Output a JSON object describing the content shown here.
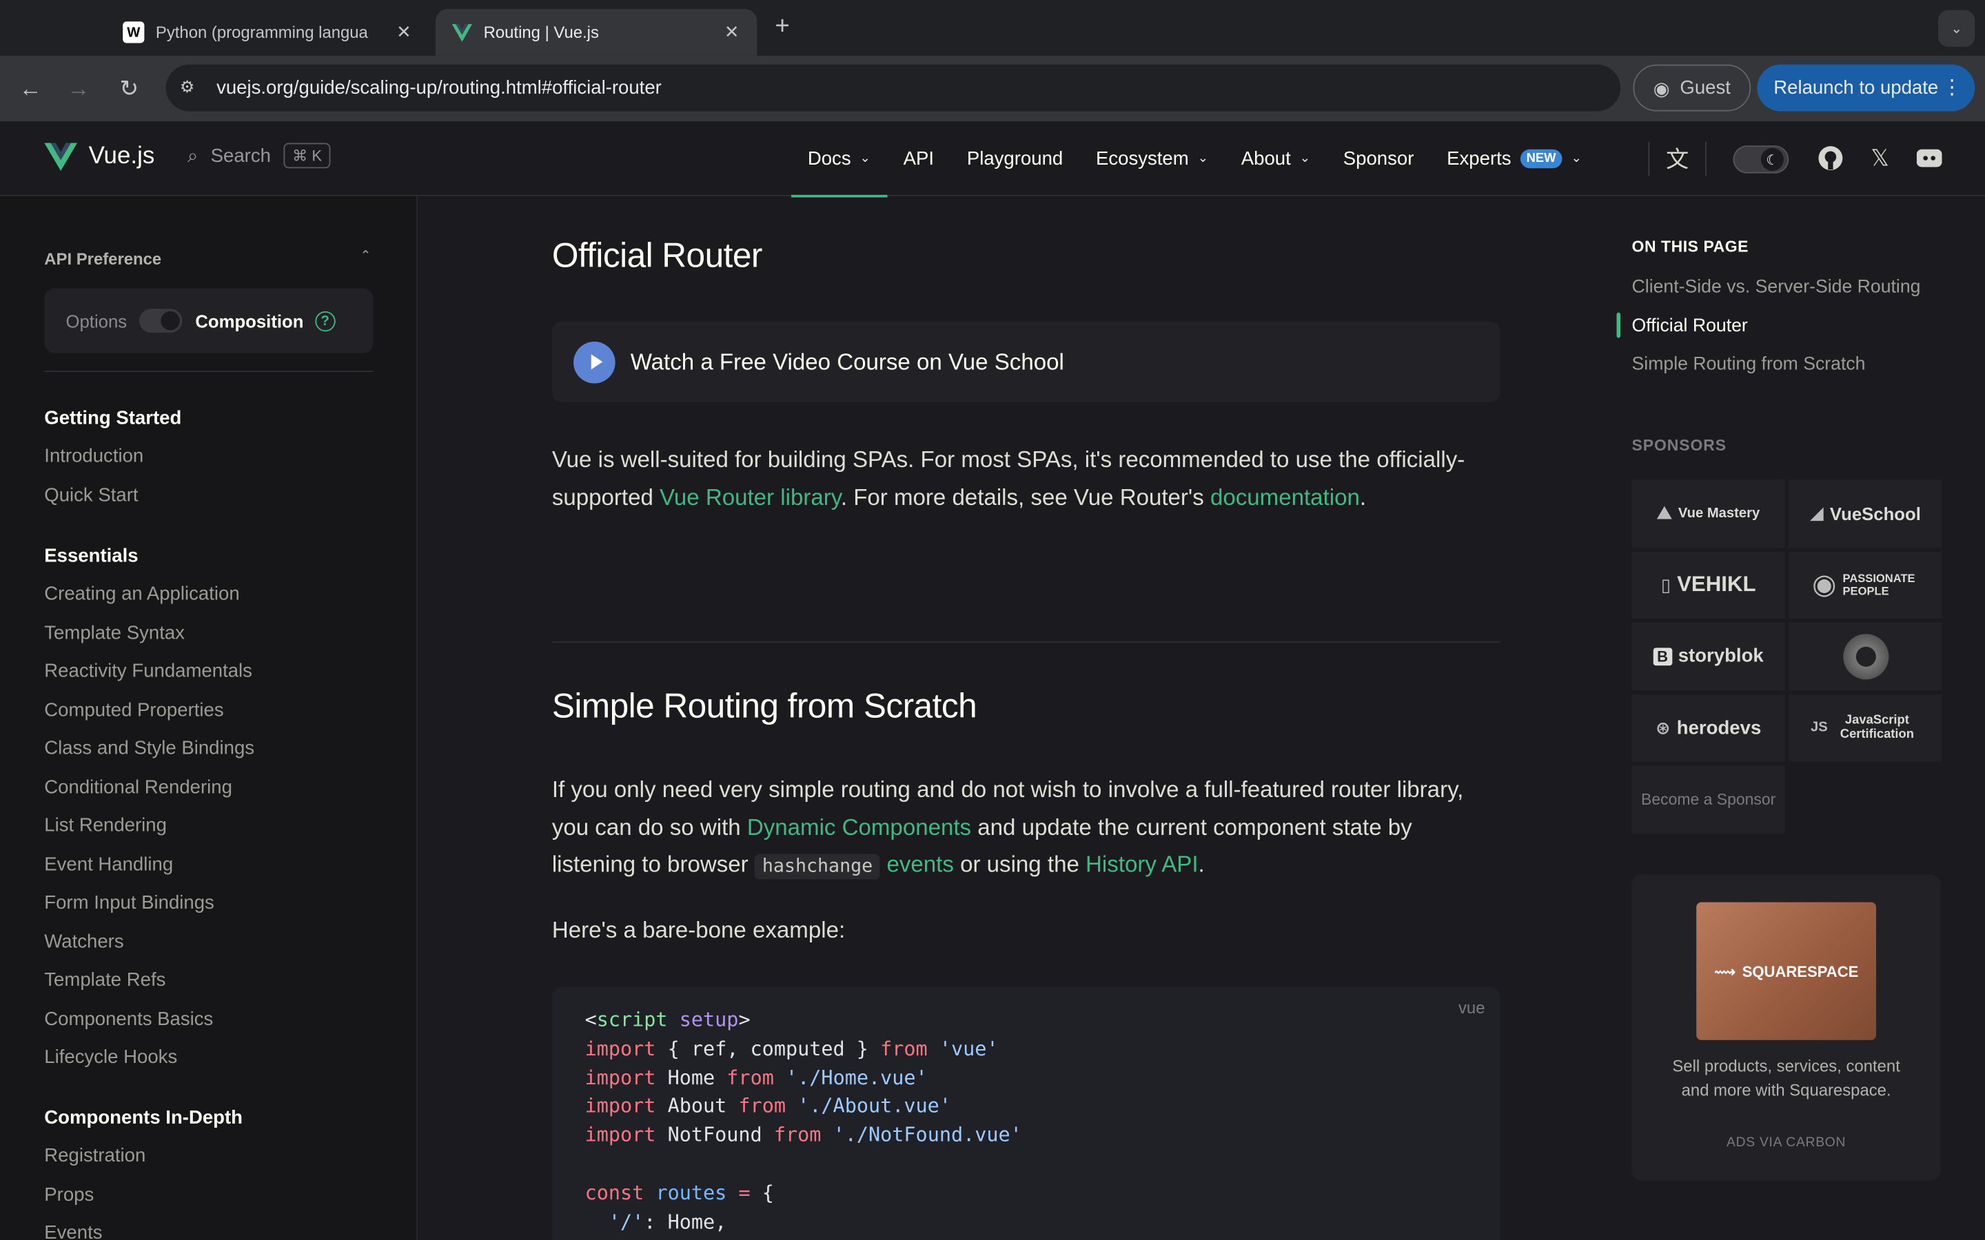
{
  "browser": {
    "tabs": [
      {
        "title": "Python (programming langua",
        "favicon": "W"
      },
      {
        "title": "Routing | Vue.js",
        "favicon": "V"
      }
    ],
    "url": "vuejs.org/guide/scaling-up/routing.html#official-router",
    "guest_label": "Guest",
    "relaunch_label": "Relaunch to update"
  },
  "nav": {
    "brand": "Vue.js",
    "search_label": "Search",
    "search_kbd": "⌘ K",
    "items": [
      {
        "label": "Docs",
        "dropdown": true
      },
      {
        "label": "API"
      },
      {
        "label": "Playground"
      },
      {
        "label": "Ecosystem",
        "dropdown": true
      },
      {
        "label": "About",
        "dropdown": true
      },
      {
        "label": "Sponsor"
      },
      {
        "label": "Experts",
        "badge": "NEW",
        "dropdown": true
      }
    ]
  },
  "sidebar": {
    "api_preference": {
      "title": "API Preference",
      "options_label": "Options",
      "composition_label": "Composition"
    },
    "groups": [
      {
        "title": "Getting Started",
        "items": [
          "Introduction",
          "Quick Start"
        ]
      },
      {
        "title": "Essentials",
        "items": [
          "Creating an Application",
          "Template Syntax",
          "Reactivity Fundamentals",
          "Computed Properties",
          "Class and Style Bindings",
          "Conditional Rendering",
          "List Rendering",
          "Event Handling",
          "Form Input Bindings",
          "Watchers",
          "Template Refs",
          "Components Basics",
          "Lifecycle Hooks"
        ]
      },
      {
        "title": "Components In-Depth",
        "items": [
          "Registration",
          "Props",
          "Events"
        ]
      }
    ]
  },
  "main": {
    "h_official": "Official Router",
    "video_label": "Watch a Free Video Course on Vue School",
    "p1": {
      "t1": "Vue is well-suited for building SPAs. For most SPAs, it's recommended to use the officially-supported ",
      "link1": "Vue Router library",
      "t2": ". For more details, see Vue Router's ",
      "link2": "documentation",
      "t3": "."
    },
    "h_simple": "Simple Routing from Scratch",
    "p2": {
      "t1": "If you only need very simple routing and do not wish to involve a full-featured router library, you can do so with ",
      "link1": "Dynamic Components",
      "t2": " and update the current component state by listening to browser ",
      "code": "hashchange",
      "link2": "events",
      "t3": " or using the ",
      "link3": "History API",
      "t4": "."
    },
    "p3": "Here's a bare-bone example:",
    "code_lang": "vue"
  },
  "aside": {
    "on_this_page": "ON THIS PAGE",
    "toc": [
      "Client-Side vs. Server-Side Routing",
      "Official Router",
      "Simple Routing from Scratch"
    ],
    "sponsors_title": "SPONSORS",
    "sponsors": [
      "Vue Mastery",
      "VueSchool",
      "VEHIKL",
      "PASSIONATE PEOPLE",
      "storyblok",
      "",
      "herodevs",
      "JavaScript Certification",
      "Become a Sponsor"
    ],
    "ad": {
      "brand": "SQUARESPACE",
      "text": "Sell products, services, content and more with Squarespace.",
      "via": "ADS VIA CARBON"
    }
  }
}
